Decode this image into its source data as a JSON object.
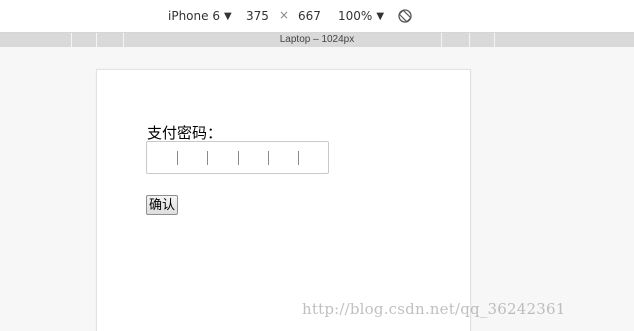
{
  "toolbar": {
    "device": "iPhone 6",
    "width": "375",
    "x_sign": "×",
    "height": "667",
    "zoom": "100%",
    "caret": "▼",
    "rotate_icon": "rotate-icon"
  },
  "media_bar": {
    "label": "Laptop – 1024px"
  },
  "form": {
    "password_label": "支付密码：",
    "confirm_label": "确认"
  },
  "watermark": "http://blog.csdn.net/qq_36242361"
}
